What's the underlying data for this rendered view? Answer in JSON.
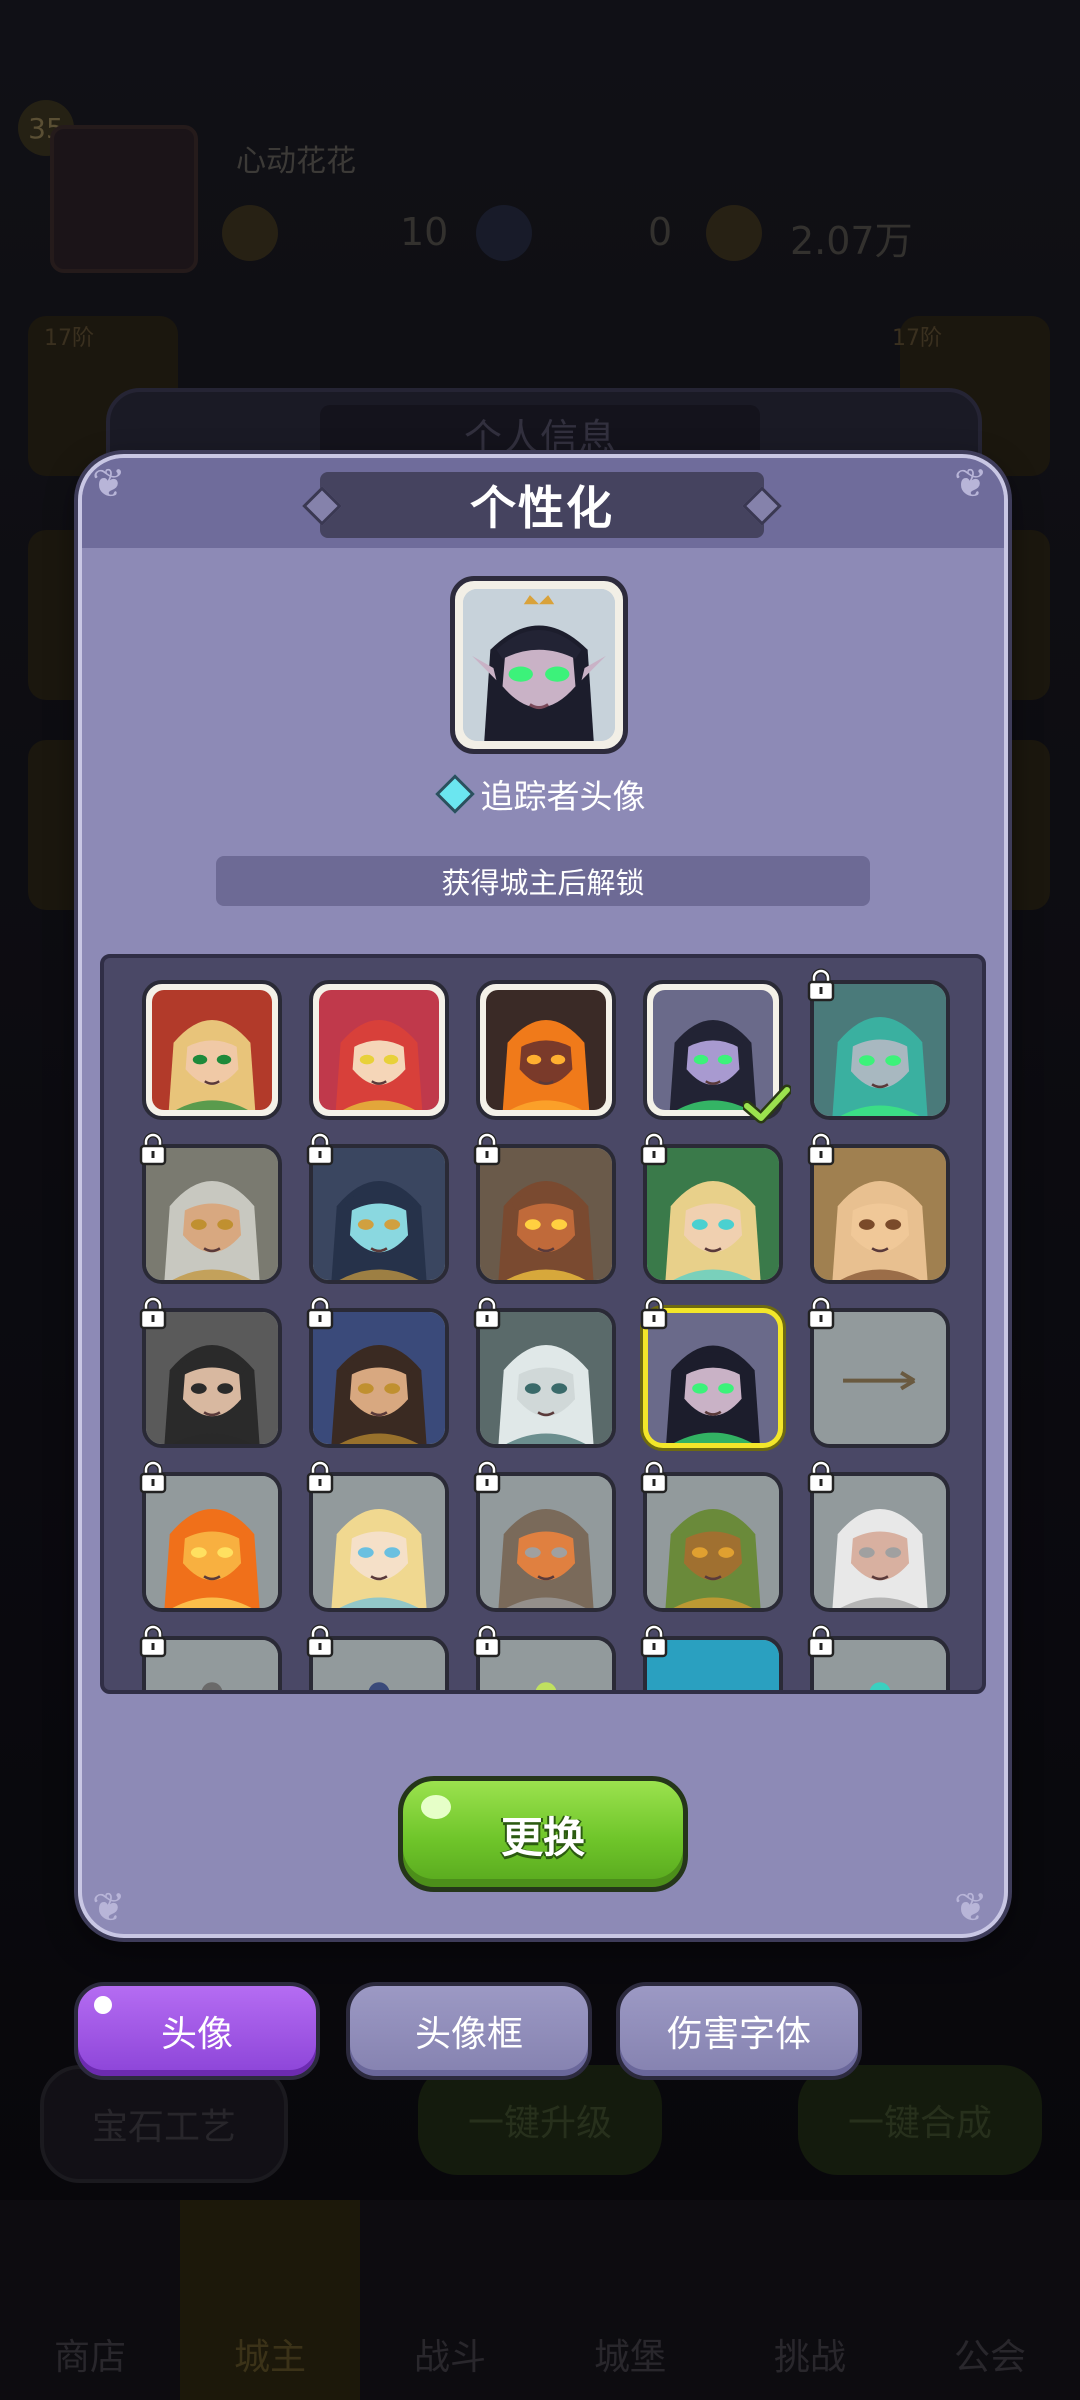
{
  "background": {
    "level": "35",
    "player_name": "心动花花",
    "resource_1": "10",
    "resource_2": "0",
    "resource_3": "2.07万",
    "side_tag": "17阶",
    "panel_title": "个人信息",
    "button_gem_craft": "宝石工艺",
    "button_upgrade_all": "一键升级",
    "button_merge_all": "一键合成",
    "nav": [
      {
        "label": "商店",
        "icon": "shop-icon"
      },
      {
        "label": "城主",
        "icon": "lord-icon"
      },
      {
        "label": "战斗",
        "icon": "battle-icon"
      },
      {
        "label": "城堡",
        "icon": "castle-icon"
      },
      {
        "label": "挑战",
        "icon": "challenge-icon"
      },
      {
        "label": "公会",
        "icon": "guild-icon"
      }
    ]
  },
  "dialog": {
    "title": "个性化",
    "selected_avatar_name": "追踪者头像",
    "unlock_hint": "获得城主后解锁",
    "change_button": "更换"
  },
  "avatars": [
    {
      "id": "blonde-warrior",
      "locked": false,
      "selected": false,
      "equipped": false
    },
    {
      "id": "red-hair-queen",
      "locked": false,
      "selected": false,
      "equipped": false
    },
    {
      "id": "fire-demon",
      "locked": false,
      "selected": false,
      "equipped": false
    },
    {
      "id": "purple-elf",
      "locked": false,
      "selected": false,
      "equipped": true
    },
    {
      "id": "teal-elf",
      "locked": true,
      "selected": false,
      "equipped": false
    },
    {
      "id": "old-paladin",
      "locked": true,
      "selected": false,
      "equipped": false
    },
    {
      "id": "skull-knight",
      "locked": true,
      "selected": false,
      "equipped": false
    },
    {
      "id": "orc",
      "locked": true,
      "selected": false,
      "equipped": false
    },
    {
      "id": "forest-elf",
      "locked": true,
      "selected": false,
      "equipped": false
    },
    {
      "id": "monk",
      "locked": true,
      "selected": false,
      "equipped": false
    },
    {
      "id": "dark-rogue",
      "locked": true,
      "selected": false,
      "equipped": false
    },
    {
      "id": "bearded-warrior",
      "locked": true,
      "selected": false,
      "equipped": false
    },
    {
      "id": "white-hair-knight",
      "locked": true,
      "selected": false,
      "equipped": false
    },
    {
      "id": "tracker",
      "locked": true,
      "selected": true,
      "equipped": false
    },
    {
      "id": "arrow",
      "locked": true,
      "selected": false,
      "equipped": false
    },
    {
      "id": "fire-spirit",
      "locked": true,
      "selected": false,
      "equipped": false
    },
    {
      "id": "blonde-priestess",
      "locked": true,
      "selected": false,
      "equipped": false
    },
    {
      "id": "hammer-dwarf",
      "locked": true,
      "selected": false,
      "equipped": false
    },
    {
      "id": "treant",
      "locked": true,
      "selected": false,
      "equipped": false
    },
    {
      "id": "old-sage",
      "locked": true,
      "selected": false,
      "equipped": false
    },
    {
      "id": "partial-1",
      "locked": true,
      "selected": false,
      "equipped": false
    },
    {
      "id": "partial-2",
      "locked": true,
      "selected": false,
      "equipped": false
    },
    {
      "id": "partial-3",
      "locked": true,
      "selected": false,
      "equipped": false
    },
    {
      "id": "partial-4",
      "locked": true,
      "selected": false,
      "equipped": false
    },
    {
      "id": "partial-5",
      "locked": true,
      "selected": false,
      "equipped": false
    }
  ],
  "tabs": [
    {
      "label": "头像",
      "active": true
    },
    {
      "label": "头像框",
      "active": false
    },
    {
      "label": "伤害字体",
      "active": false
    }
  ],
  "colors": {
    "dialog_bg": "#8d8ab6",
    "accent_green": "#6fc52a",
    "active_tab": "#8c44d8",
    "selection": "#f3e62a"
  }
}
